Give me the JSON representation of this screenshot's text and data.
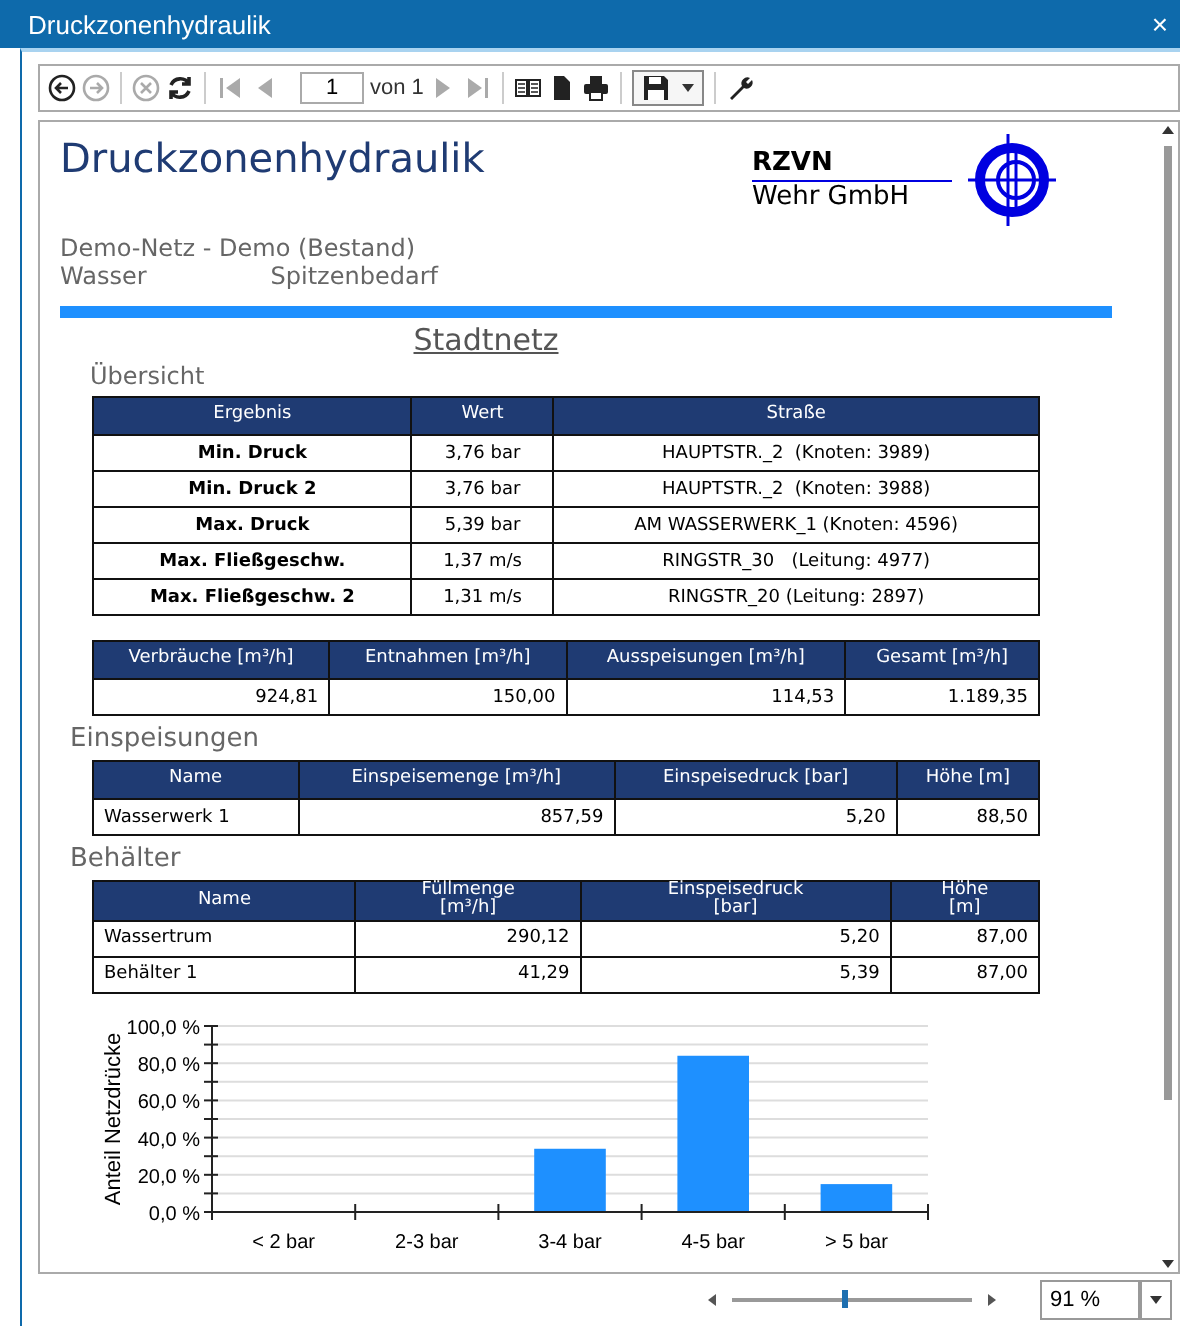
{
  "window": {
    "title": "Druckzonenhydraulik",
    "close": "×"
  },
  "toolbar": {
    "page": "1",
    "page_of": "von 1"
  },
  "report": {
    "title": "Druckzonenhydraulik",
    "company_line1": "RZVN",
    "company_line2": "Wehr GmbH",
    "network": "Demo-Netz - Demo (Bestand)",
    "medium": "Wasser",
    "scenario": "Spitzenbedarf",
    "zone": "Stadtnetz",
    "overview": {
      "heading": "Übersicht",
      "columns": [
        "Ergebnis",
        "Wert",
        "Straße"
      ],
      "rows": [
        [
          "Min. Druck",
          "3,76 bar",
          "HAUPTSTR._2  (Knoten: 3989)"
        ],
        [
          "Min. Druck 2",
          "3,76 bar",
          "HAUPTSTR._2  (Knoten: 3988)"
        ],
        [
          "Max. Druck",
          "5,39 bar",
          "AM WASSERWERK_1 (Knoten: 4596)"
        ],
        [
          "Max. Fließgeschw.",
          "1,37 m/s",
          "RINGSTR_30   (Leitung: 4977)"
        ],
        [
          "Max. Fließgeschw. 2",
          "1,31 m/s",
          "RINGSTR_20 (Leitung: 2897)"
        ]
      ]
    },
    "totals": {
      "columns": [
        "Verbräuche [m³/h]",
        "Entnahmen [m³/h]",
        "Ausspeisungen [m³/h]",
        "Gesamt [m³/h]"
      ],
      "rows": [
        [
          "924,81",
          "150,00",
          "114,53",
          "1.189,35"
        ]
      ]
    },
    "feeds": {
      "heading": "Einspeisungen",
      "columns": [
        "Name",
        "Einspeisemenge [m³/h]",
        "Einspeisedruck [bar]",
        "Höhe [m]"
      ],
      "rows": [
        [
          "Wasserwerk 1",
          "857,59",
          "5,20",
          "88,50"
        ]
      ]
    },
    "tanks": {
      "heading": "Behälter",
      "columns": [
        "Name",
        "Füllmenge\n[m³/h]",
        "Einspeisedruck\n[bar]",
        "Höhe\n[m]"
      ],
      "rows": [
        [
          "Wassertrum",
          "290,12",
          "5,20",
          "87,00"
        ],
        [
          "Behälter 1",
          "41,29",
          "5,39",
          "87,00"
        ]
      ]
    },
    "chart_data": {
      "type": "bar",
      "ylabel": "Anteil Netzdrücke",
      "categories": [
        "< 2 bar",
        "2-3 bar",
        "3-4 bar",
        "4-5 bar",
        "> 5 bar"
      ],
      "grid": true,
      "series": [
        {
          "color": "#1e90ff",
          "values": [
            0,
            0,
            34,
            84,
            15
          ]
        }
      ],
      "ylim": [
        0,
        100
      ],
      "yticks": [
        {
          "value": 0,
          "label": "0,0 %"
        },
        {
          "value": 20,
          "label": "20,0 %"
        },
        {
          "value": 40,
          "label": "40,0 %"
        },
        {
          "value": 60,
          "label": "60,0 %"
        },
        {
          "value": 80,
          "label": "80,0 %"
        },
        {
          "value": 100,
          "label": "100,0 %"
        }
      ]
    }
  },
  "status_bar": {
    "zoom": {
      "level": 0.46
    },
    "zoom_value": "91 %"
  }
}
